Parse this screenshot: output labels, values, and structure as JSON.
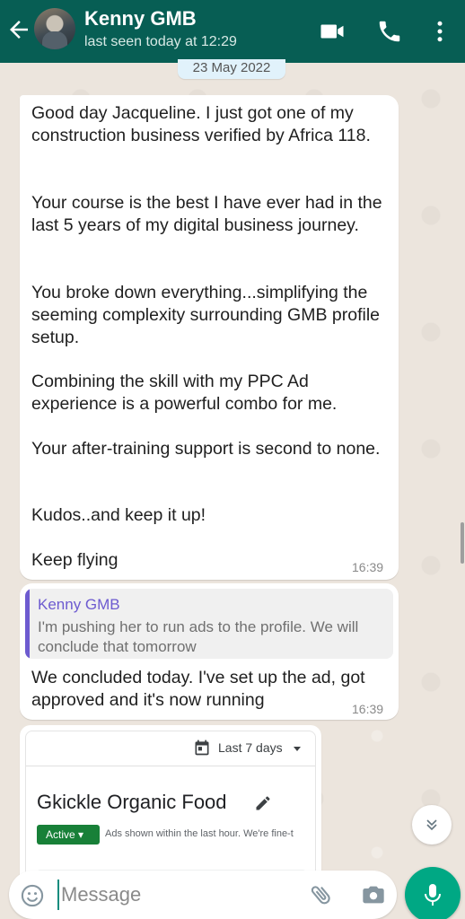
{
  "header": {
    "contact_name": "Kenny GMB",
    "status": "last seen today at 12:29",
    "icons": [
      "back-arrow-icon",
      "video-call-icon",
      "voice-call-icon",
      "more-options-icon"
    ]
  },
  "date_chip": "23 May 2022",
  "messages": [
    {
      "paragraphs": [
        "Good day Jacqueline. I just got one of my construction business verified by Africa 118.",
        "Your course is the best I have ever had in the last 5 years of my digital business journey.",
        "You broke down everything...simplifying the seeming complexity surrounding GMB profile setup.",
        "Combining the skill with my PPC Ad experience is a powerful combo for me.",
        "Your after-training support is second to none.",
        "Kudos..and keep it up!",
        "Keep flying"
      ],
      "time": "16:39"
    },
    {
      "quote": {
        "author": "Kenny GMB",
        "text": "I'm pushing her to run ads to the profile. We will conclude that tomorrow"
      },
      "text": "We concluded today. I've set up the ad, got approved and it's now running",
      "time": "16:39"
    }
  ],
  "ad_card": {
    "date_range": "Last 7 days",
    "campaign_name": "Gkickle Organic Food",
    "status": "Active",
    "status_note": "Ads shown within the last hour. We're fine-t"
  },
  "composer": {
    "placeholder": "Message"
  },
  "colors": {
    "header": "#075e54",
    "accent": "#00a884",
    "quote_author": "#6d5bd0",
    "status_active": "#188038"
  }
}
